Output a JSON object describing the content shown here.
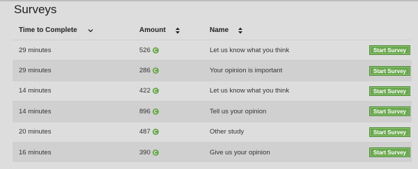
{
  "page": {
    "title": "Surveys"
  },
  "table": {
    "headers": {
      "time": "Time to Complete",
      "amount": "Amount",
      "name": "Name"
    },
    "rows": [
      {
        "time": "29 minutes",
        "amount": "526",
        "name": "Let us know what you think",
        "action": "Start Survey"
      },
      {
        "time": "29 minutes",
        "amount": "286",
        "name": "Your opinion is important",
        "action": "Start Survey"
      },
      {
        "time": "14 minutes",
        "amount": "422",
        "name": "Let us know what you think",
        "action": "Start Survey"
      },
      {
        "time": "14 minutes",
        "amount": "896",
        "name": "Tell us your opinion",
        "action": "Start Survey"
      },
      {
        "time": "20 minutes",
        "amount": "487",
        "name": "Other study",
        "action": "Start Survey"
      },
      {
        "time": "16 minutes",
        "amount": "390",
        "name": "Give us your opinion",
        "action": "Start Survey"
      }
    ]
  },
  "colors": {
    "accent": "#6aa84f",
    "background": "#dddddd",
    "row_alt": "#d0d0d0"
  },
  "icons": {
    "time_header": "chevron-down-icon",
    "amount_header": "sort-icon",
    "name_header": "sort-icon",
    "amount": "coin-icon"
  }
}
